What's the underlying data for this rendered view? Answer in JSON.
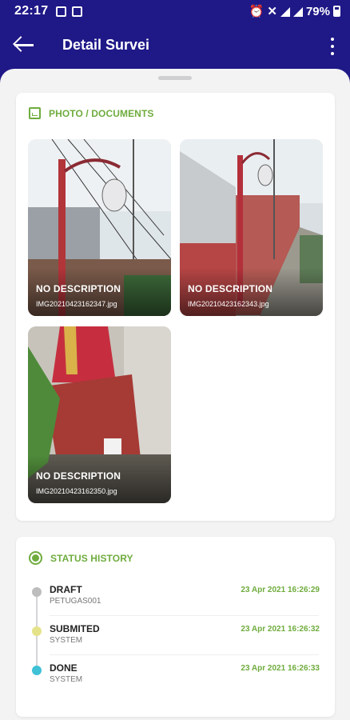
{
  "status_bar": {
    "time": "22:17",
    "battery": "79%"
  },
  "app_bar": {
    "title": "Detail Survei"
  },
  "photos_section": {
    "heading": "PHOTO / DOCUMENTS",
    "items": [
      {
        "description": "NO DESCRIPTION",
        "file_name": "IMG20210423162347.jpg"
      },
      {
        "description": "NO DESCRIPTION",
        "file_name": "IMG20210423162343.jpg"
      },
      {
        "description": "NO DESCRIPTION",
        "file_name": "IMG20210423162350.jpg"
      }
    ]
  },
  "status_section": {
    "heading": "STATUS HISTORY",
    "items": [
      {
        "state": "DRAFT",
        "by": "PETUGAS001",
        "time": "23 Apr 2021 16:26:29",
        "color": "#bdbdbd"
      },
      {
        "state": "SUBMITED",
        "by": "SYSTEM",
        "time": "23 Apr 2021 16:26:32",
        "color": "#e5e38a"
      },
      {
        "state": "DONE",
        "by": "SYSTEM",
        "time": "23 Apr 2021 16:26:33",
        "color": "#3fc1d6"
      }
    ]
  },
  "colors": {
    "primary": "#1f1887",
    "accent": "#6fac3e"
  },
  "icons": [
    "back-arrow-icon",
    "more-vert-icon",
    "document-icon",
    "status-dot-icon"
  ]
}
